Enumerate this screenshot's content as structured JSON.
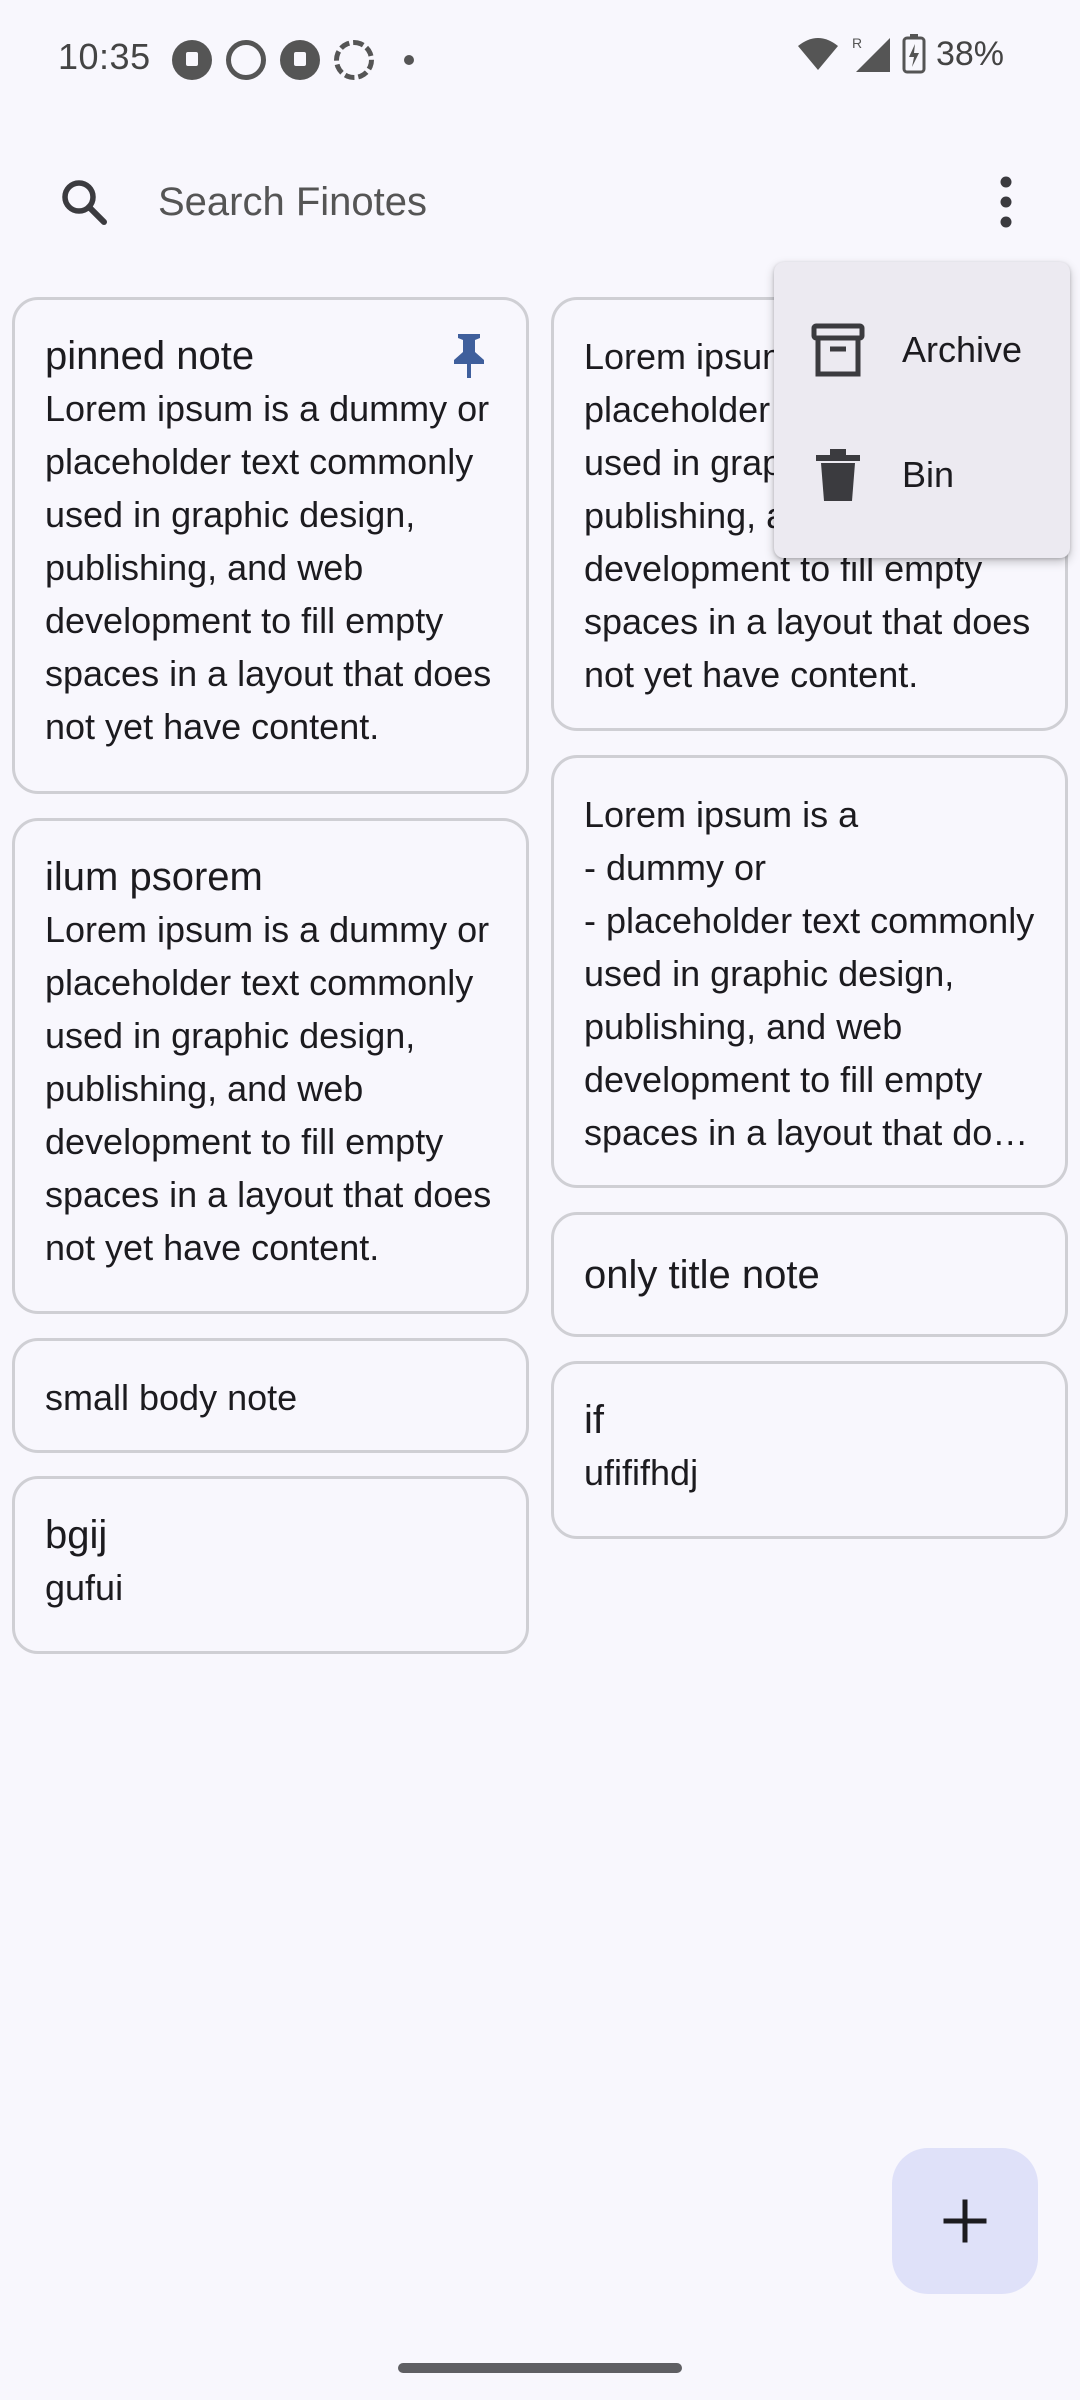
{
  "status_bar": {
    "time": "10:35",
    "battery": "38%",
    "notification_icons": [
      "signal-chat-icon",
      "whatsapp-icon",
      "signal-chat-icon",
      "signal-icon",
      "more-dot-icon"
    ],
    "system_icons": [
      "wifi-icon",
      "roaming-signal-icon",
      "battery-charging-icon"
    ]
  },
  "search": {
    "placeholder": "Search Finotes",
    "value": ""
  },
  "menu": {
    "items": [
      {
        "label": "Archive",
        "icon": "archive-icon"
      },
      {
        "label": "Bin",
        "icon": "trash-icon"
      }
    ]
  },
  "notes_left": [
    {
      "title": "pinned note",
      "body": "Lorem ipsum is a dummy or placeholder text commonly used in graphic design, publishing, and web development to fill empty spaces in a layout that does not yet have content.",
      "pinned": true
    },
    {
      "title": "ilum psorem",
      "body": "Lorem ipsum is a dummy or placeholder text commonly used in graphic design, publishing, and web development to fill empty spaces in a layout that does not yet have content."
    },
    {
      "title": "",
      "body": "small body note"
    },
    {
      "title": "bgij",
      "body": "gufui"
    }
  ],
  "notes_right": [
    {
      "title": "",
      "body": "Lorem ipsum is a dummy or placeholder text commonly used in graphic design, publishing, and web development to fill empty spaces in a layout that does not yet have content."
    },
    {
      "title": "",
      "body": "Lorem ipsum is a\n- dummy or\n- placeholder text commonly used in graphic design, publishing, and web development to fill empty spaces in a layout that does not yet have content."
    },
    {
      "title": "only title note",
      "body": ""
    },
    {
      "title": "if",
      "body": "ufifіfhdj"
    }
  ],
  "fab": {
    "icon": "add-icon"
  },
  "colors": {
    "background": "#f8f7fd",
    "card_border": "#cfcfd4",
    "pin": "#3f5f9c",
    "fab": "#dfe1f9",
    "menu": "#eceaf1"
  }
}
